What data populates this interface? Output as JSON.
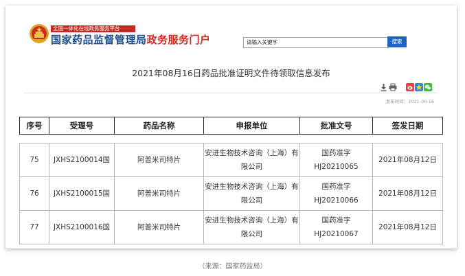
{
  "header": {
    "platform_sub": "全国一体化在线政务服务平台",
    "brand_blue": "国家药品监督管理局",
    "brand_red": "政务服务门户",
    "search_value": "请输入关键字",
    "search_button": "搜索"
  },
  "article": {
    "title": "2021年08月16日药品批准证明文件待领取信息发布",
    "publish_label": "发布时间：",
    "publish_date": "2021-08-16"
  },
  "colors": {
    "brand_blue": "#1b4f8f",
    "brand_red": "#d2281c",
    "search_button": "#1f64c2"
  },
  "icons": [
    "national-emblem-icon",
    "download-icon",
    "print-icon",
    "weibo-icon",
    "qzone-icon",
    "wechat-icon"
  ],
  "table": {
    "headers": [
      "序号",
      "受理号",
      "药品名称",
      "申报单位",
      "批准文号",
      "签发日期"
    ],
    "rows": [
      [
        "75",
        "JXHS2100014国",
        "阿普米司特片",
        "安进生物技术咨询（上海）有限公司",
        "国药准字HJ20210065",
        "2021年08月12日"
      ],
      [
        "76",
        "JXHS2100015国",
        "阿普米司特片",
        "安进生物技术咨询（上海）有限公司",
        "国药准字HJ20210066",
        "2021年08月12日"
      ],
      [
        "77",
        "JXHS2100016国",
        "阿普米司特片",
        "安进生物技术咨询（上海）有限公司",
        "国药准字HJ20210067",
        "2021年08月12日"
      ]
    ]
  },
  "caption": "（来源：国家药监局）"
}
